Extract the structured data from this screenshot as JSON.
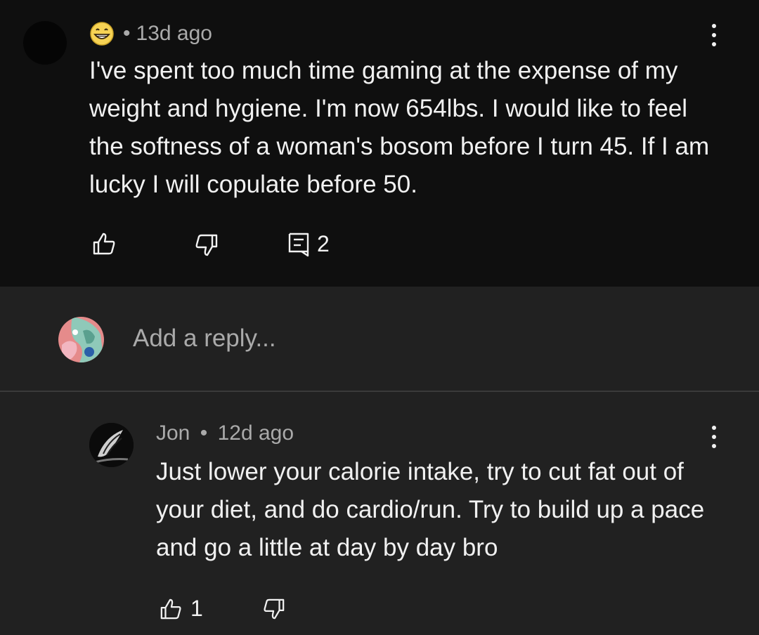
{
  "top_comment": {
    "author": "",
    "time": "13d ago",
    "separator": "•",
    "text": "I've spent too much time gaming at the expense of my weight and hygiene. I'm now 654lbs. I would like to feel the softness of a woman's bosom before I turn 45. If I am lucky I will copulate before 50.",
    "reply_count": "2",
    "author_badge_icon": "grinning-face-emoji-icon"
  },
  "reply_box": {
    "placeholder": "Add a reply..."
  },
  "reply": {
    "author": "Jon",
    "separator": "•",
    "time": "12d ago",
    "text": "Just lower your calorie intake, try to cut fat out of your diet, and do cardio/run. Try to build up a pace and go a little at day by day bro",
    "like_count": "1"
  },
  "colors": {
    "top_comment_bg": "#0f0f0f",
    "page_bg": "#212121",
    "text_primary": "#f1f1f1",
    "text_secondary": "#aaaaaa"
  }
}
